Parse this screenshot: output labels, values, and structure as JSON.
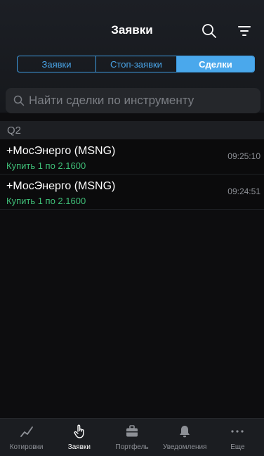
{
  "header": {
    "title": "Заявки"
  },
  "segments": [
    {
      "label": "Заявки",
      "active": false
    },
    {
      "label": "Стоп-заявки",
      "active": false
    },
    {
      "label": "Сделки",
      "active": true
    }
  ],
  "search": {
    "placeholder": "Найти сделки по инструменту",
    "value": ""
  },
  "section": {
    "label": "Q2"
  },
  "trades": [
    {
      "instrument": "+МосЭнерго (MSNG)",
      "detail": "Купить 1  по 2.1600",
      "time": "09:25:10"
    },
    {
      "instrument": "+МосЭнерго (MSNG)",
      "detail": "Купить 1  по 2.1600",
      "time": "09:24:51"
    }
  ],
  "tabbar": {
    "items": [
      {
        "label": "Котировки",
        "icon": "chart-line-icon",
        "active": false
      },
      {
        "label": "Заявки",
        "icon": "hand-icon",
        "active": true
      },
      {
        "label": "Портфель",
        "icon": "briefcase-icon",
        "active": false
      },
      {
        "label": "Уведомления",
        "icon": "bell-icon",
        "active": false
      },
      {
        "label": "Еще",
        "icon": "more-dots-icon",
        "active": false
      }
    ]
  },
  "colors": {
    "accent": "#4aa8ec",
    "buy": "#3fbf78",
    "background": "#0d0d0f"
  }
}
